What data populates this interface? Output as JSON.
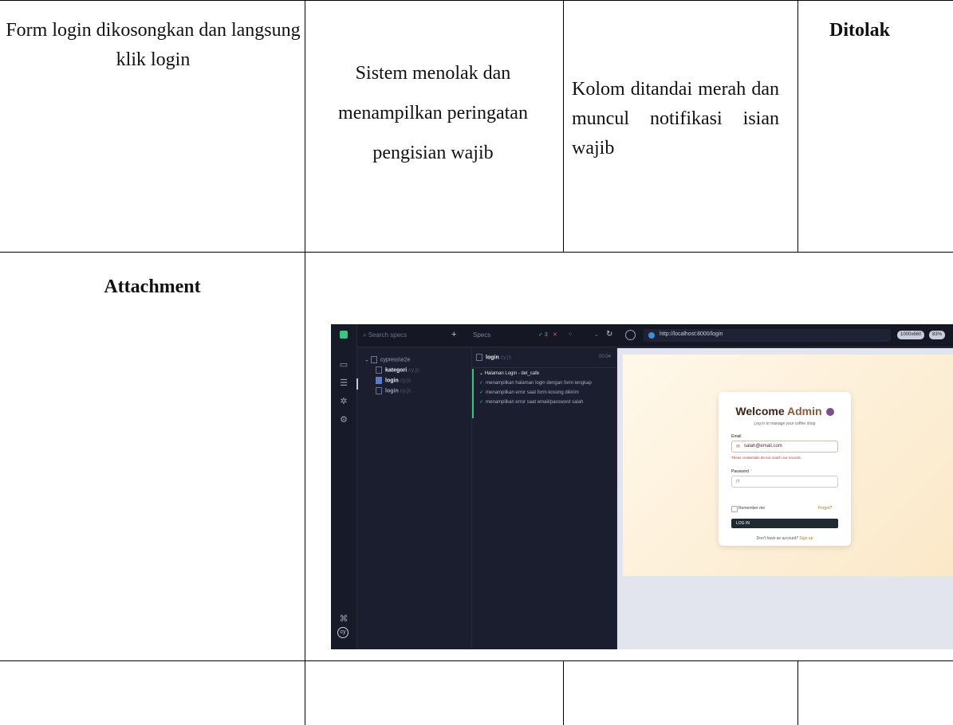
{
  "row1": {
    "scenario": "Form login dikosongkan dan langsung klik login",
    "expected": "Sistem menolak dan menampilkan peringatan pengisian wajib",
    "actual": "Kolom ditandai merah dan muncul notifikasi isian wajib",
    "status": "Ditolak"
  },
  "attachment": {
    "label": "Attachment"
  },
  "screenshot": {
    "search_placeholder": "Search specs",
    "specs_label": "Specs",
    "pass_count": "✓ 3",
    "fail_count": "✕",
    "pending": "○",
    "url": "http://localhost:8000/login",
    "viewport_badge": "1000x660",
    "zoom_badge": "83%",
    "tree": {
      "folder": "cypress\\e2e",
      "files": [
        {
          "name": "kategori",
          "ext": ".cy.js"
        },
        {
          "name": "login",
          "ext": ".cy.js"
        },
        {
          "name": "login",
          "ext": ".cy.js"
        }
      ]
    },
    "reporter": {
      "spec_title": "login",
      "spec_ext": ".cy.js",
      "duration": "00:04",
      "suite": "Halaman Login - del_cafe",
      "tests": [
        "menampilkan halaman login dengan form lengkap",
        "menampilkan error saat form kosong dikirim",
        "menampilkan error saat email/password salah"
      ]
    },
    "login_card": {
      "title_a": "Welcome",
      "title_b": "Admin",
      "subtitle": "Log in to manage your coffee shop",
      "email_label": "Email",
      "email_value": "salah@email.com",
      "error": "These credentials do not match our records.",
      "password_label": "Password",
      "remember": "Remember me",
      "forgot": "Forgot?",
      "login_button": "LOG IN",
      "signup_prefix": "Don't have an account?",
      "signup_link": "Sign up"
    }
  }
}
